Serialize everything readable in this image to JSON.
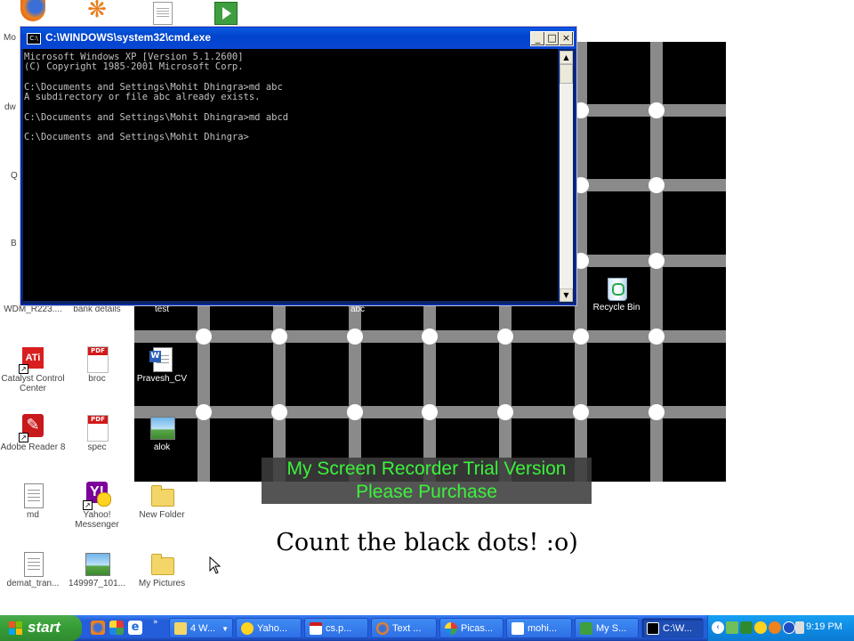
{
  "cmd_window": {
    "title": "C:\\WINDOWS\\system32\\cmd.exe",
    "icon_label": "C:\\",
    "buttons": {
      "minimize": "_",
      "maximize": "□",
      "close": "×"
    },
    "console_text": "Microsoft Windows XP [Version 5.1.2600]\n(C) Copyright 1985-2001 Microsoft Corp.\n\nC:\\Documents and Settings\\Mohit Dhingra>md abc\nA subdirectory or file abc already exists.\n\nC:\\Documents and Settings\\Mohit Dhingra>md abcd\n\nC:\\Documents and Settings\\Mohit Dhingra>"
  },
  "desktop": {
    "left_partial_labels": [
      "Mo",
      "dw",
      "Q",
      "B"
    ],
    "icons": [
      {
        "label": "WDM_R223....",
        "kind": "doc"
      },
      {
        "label": "bank details",
        "kind": "doc"
      },
      {
        "label": "test",
        "kind": "folder"
      },
      {
        "label": "abc",
        "kind": "folder"
      },
      {
        "label": "Recycle Bin",
        "kind": "recycle"
      },
      {
        "label": "Catalyst Control Center",
        "kind": "ati"
      },
      {
        "label": "broc",
        "kind": "pdf"
      },
      {
        "label": "Pravesh_CV",
        "kind": "word"
      },
      {
        "label": "Adobe Reader 8",
        "kind": "adobe"
      },
      {
        "label": "spec",
        "kind": "pdf"
      },
      {
        "label": "alok",
        "kind": "picture"
      },
      {
        "label": "md",
        "kind": "doc"
      },
      {
        "label": "Yahoo! Messenger",
        "kind": "yahoo"
      },
      {
        "label": "New Folder",
        "kind": "folder"
      },
      {
        "label": "demat_tran...",
        "kind": "doc"
      },
      {
        "label": "149997_101...",
        "kind": "picture"
      },
      {
        "label": "My Pictures",
        "kind": "folder"
      }
    ]
  },
  "wallpaper": {
    "caption": "Count the black dots! :o)"
  },
  "watermark": {
    "line1": "My Screen Recorder Trial Version",
    "line2": "Please Purchase"
  },
  "taskbar": {
    "start_label": "start",
    "buttons": [
      {
        "label": "4 W...",
        "active": false
      },
      {
        "label": "Yaho...",
        "active": false
      },
      {
        "label": "cs.p...",
        "active": false
      },
      {
        "label": "Text ...",
        "active": false
      },
      {
        "label": "Picas...",
        "active": false
      },
      {
        "label": "mohi...",
        "active": false
      },
      {
        "label": "My S...",
        "active": false
      },
      {
        "label": "C:\\W...",
        "active": true
      }
    ],
    "clock": "9:19 PM"
  },
  "colors": {
    "taskbar_blue": "#245edb",
    "start_green": "#37a037",
    "watermark_text": "#3bf23b",
    "console_bg": "#000000",
    "console_text": "#c0c0c0"
  }
}
